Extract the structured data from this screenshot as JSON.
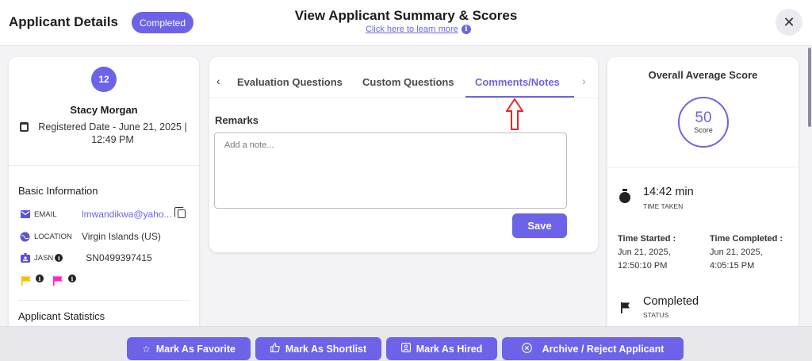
{
  "header": {
    "title": "Applicant Details",
    "status_badge": "Completed",
    "center_title": "View Applicant Summary & Scores",
    "learn_link": "Click here to learn more",
    "info_glyph": "i",
    "close_glyph": "✕"
  },
  "applicant": {
    "number": "12",
    "name": "Stacy Morgan",
    "registered": "Registered Date - June 21, 2025 | 12:49 PM"
  },
  "basic_info": {
    "title": "Basic Information",
    "email_label": "EMAIL",
    "email_value": "lmwandikwa@yaho...",
    "location_label": "LOCATION",
    "location_value": "Virgin Islands (US)",
    "jasn_label": "JASN",
    "jasn_value": "SN0499397415",
    "flag_colors": [
      "#f2c200",
      "#ff1fd2"
    ]
  },
  "statistics": {
    "title": "Applicant Statistics"
  },
  "tabs": {
    "items": [
      "Evaluation Questions",
      "Custom Questions",
      "Comments/Notes"
    ],
    "active": "Comments/Notes",
    "prev_glyph": "‹",
    "next_glyph": "›"
  },
  "remarks": {
    "label": "Remarks",
    "placeholder": "Add a note...",
    "save_label": "Save"
  },
  "score": {
    "title": "Overall Average Score",
    "value": "50",
    "unit": "Score"
  },
  "timing": {
    "time_taken": "14:42 min",
    "time_taken_label": "TIME TAKEN",
    "started_label": "Time Started :",
    "started_value": "Jun 21, 2025, 12:50:10 PM",
    "completed_label": "Time Completed :",
    "completed_value": "Jun 21, 2025, 4:05:15 PM",
    "status_value": "Completed",
    "status_label": "STATUS"
  },
  "footer": {
    "favorite": "Mark As Favorite",
    "shortlist": "Mark As Shortlist",
    "hired": "Mark As Hired",
    "archive": "Archive / Reject Applicant"
  },
  "colors": {
    "accent": "#6c63e8",
    "annotation_arrow": "#e8262a"
  }
}
